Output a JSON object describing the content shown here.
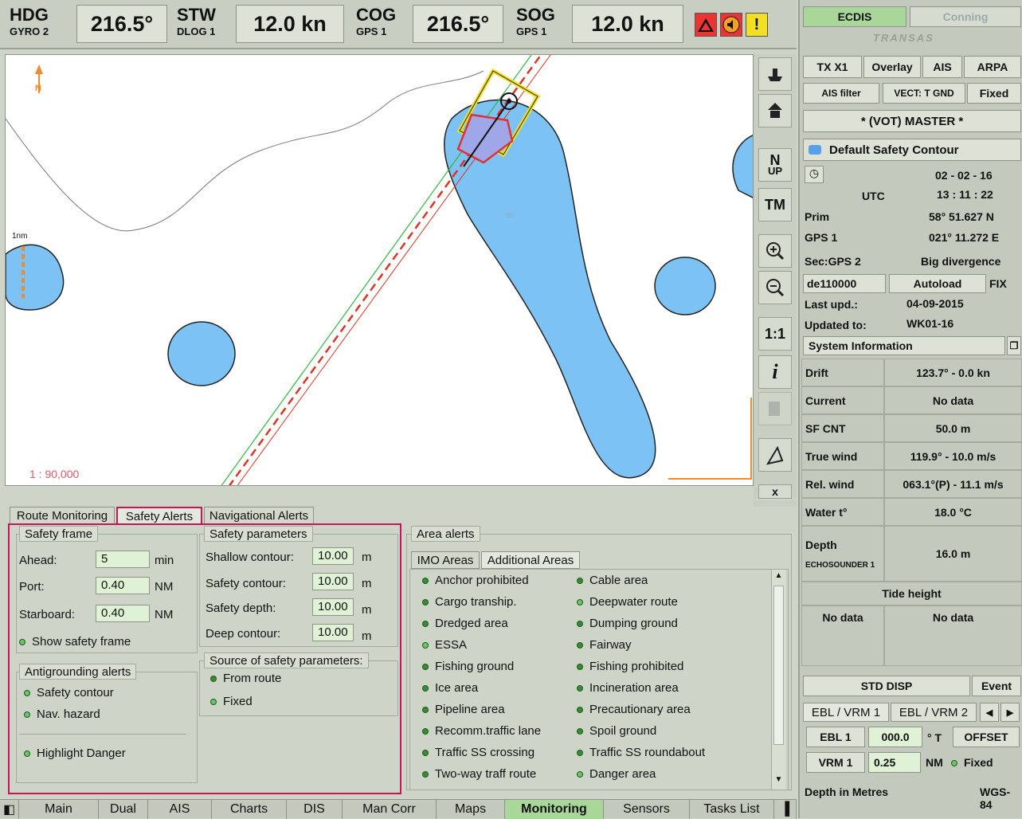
{
  "topbar": {
    "hdg": {
      "label": "HDG",
      "source": "GYRO 2",
      "value": "216.5°"
    },
    "stw": {
      "label": "STW",
      "source": "DLOG 1",
      "value": "12.0 kn"
    },
    "cog": {
      "label": "COG",
      "source": "GPS 1",
      "value": "216.5°"
    },
    "sog": {
      "label": "SOG",
      "source": "GPS 1",
      "value": "12.0 kn"
    },
    "alarm_icon": "!"
  },
  "map": {
    "north_label": "N",
    "scale_label": "1nm",
    "scale_ratio": "1 : 90,000",
    "depth_label": "db"
  },
  "tools": {
    "north_up": "N",
    "north_up_sub": "UP",
    "tm": "TM",
    "one_to_one": "1:1",
    "info": "i",
    "close": "x"
  },
  "right": {
    "tab_ecdis": "ECDIS",
    "tab_conning": "Conning",
    "brand": "TRANSAS",
    "tx": "TX X1",
    "overlay": "Overlay",
    "ais": "AIS",
    "arpa": "ARPA",
    "ais_filter": "AIS filter",
    "vect": "VECT: T GND",
    "fixed": "Fixed",
    "master": "* (VOT) MASTER *",
    "safety_contour_sel": "Default Safety Contour",
    "date": "02 - 02 - 16",
    "utc": "UTC",
    "time": "13 : 11 : 22",
    "prim": "Prim",
    "gps1": "GPS 1",
    "lat": "58° 51.627 N",
    "lon": "021° 11.272 E",
    "sec": "Sec:GPS 2",
    "divergence": "Big divergence",
    "chart": "de110000",
    "autoload": "Autoload",
    "fix": "FIX",
    "last_upd_label": "Last upd.:",
    "last_upd": "04-09-2015",
    "updated_to_label": "Updated to:",
    "updated_to": "WK01-16",
    "sysinfo": "System Information",
    "rows": [
      {
        "label": "Drift",
        "value": "123.7° - 0.0 kn"
      },
      {
        "label": "Current",
        "value": "No data"
      },
      {
        "label": "SF CNT",
        "value": "50.0 m"
      },
      {
        "label": "True wind",
        "value": "119.9° - 10.0 m/s"
      },
      {
        "label": "Rel. wind",
        "value": "063.1°(P) - 11.1 m/s"
      },
      {
        "label": "Water t°",
        "value": "18.0 °C"
      }
    ],
    "depth_label": "Depth",
    "depth_src": "ECHOSOUNDER 1",
    "depth_value": "16.0 m",
    "tide_label": "Tide height",
    "tide_left": "No data",
    "tide_right": "No data",
    "std_disp": "STD DISP",
    "event": "Event",
    "ebl_tab1": "EBL / VRM 1",
    "ebl_tab2": "EBL / VRM 2",
    "ebl1": "EBL 1",
    "ebl1_val": "000.0",
    "ebl1_unit": "° T",
    "offset": "OFFSET",
    "vrm1": "VRM 1",
    "vrm1_val": "0.25",
    "vrm1_unit": "NM",
    "vrm_fixed": "Fixed",
    "depth_units": "Depth in Metres",
    "datum": "WGS-84"
  },
  "panel_tabs": [
    "Route Monitoring",
    "Safety Alerts",
    "Navigational Alerts"
  ],
  "safety_frame": {
    "title": "Safety frame",
    "ahead_label": "Ahead:",
    "ahead": "5",
    "ahead_unit": "min",
    "port_label": "Port:",
    "port": "0.40",
    "port_unit": "NM",
    "starboard_label": "Starboard:",
    "starboard": "0.40",
    "starboard_unit": "NM",
    "show": "Show safety frame"
  },
  "antigrounding": {
    "title": "Antigrounding alerts",
    "safety_contour": "Safety contour",
    "nav_hazard": "Nav. hazard",
    "highlight": "Highlight Danger"
  },
  "safety_params": {
    "title": "Safety parameters",
    "shallow_label": "Shallow contour:",
    "shallow": "10.00",
    "safety_label": "Safety contour:",
    "safety": "10.00",
    "depth_label": "Safety depth:",
    "depth": "10.00",
    "deep_label": "Deep contour:",
    "deep": "10.00",
    "unit": "m"
  },
  "source": {
    "title": "Source of safety parameters:",
    "from_route": "From route",
    "fixed": "Fixed"
  },
  "area_alerts": {
    "title": "Area alerts",
    "tab_imo": "IMO Areas",
    "tab_additional": "Additional Areas",
    "left": [
      "Anchor prohibited",
      "Cargo tranship.",
      "Dredged area",
      "ESSA",
      "Fishing ground",
      "Ice area",
      "Pipeline area",
      "Recomm.traffic lane",
      "Traffic SS crossing",
      "Two-way traff route"
    ],
    "right": [
      "Cable area",
      "Deepwater route",
      "Dumping ground",
      "Fairway",
      "Fishing prohibited",
      "Incineration area",
      "Precautionary area",
      "Spoil ground",
      "Traffic SS roundabout",
      "Danger area"
    ]
  },
  "bottombar": {
    "items": [
      "Main",
      "Dual",
      "AIS",
      "Charts",
      "DIS",
      "Man Corr",
      "Maps",
      "Monitoring",
      "Sensors",
      "Tasks List"
    ],
    "active": "Monitoring"
  }
}
